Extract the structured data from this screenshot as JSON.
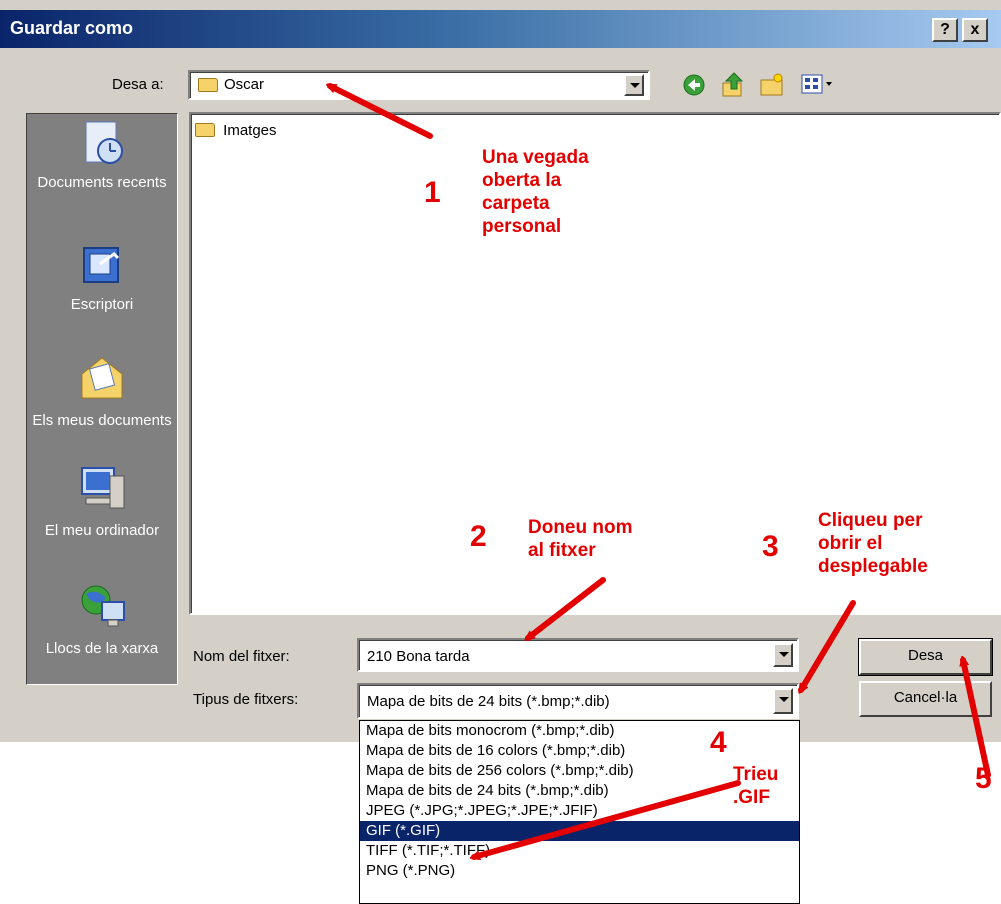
{
  "window": {
    "title": "Guardar como",
    "help_button": "?",
    "close_button": "x"
  },
  "toolbar": {
    "save_in_label": "Desa a:",
    "save_in_value": "Oscar",
    "icons": [
      "back-icon",
      "up-folder-icon",
      "new-folder-icon",
      "view-menu-icon"
    ]
  },
  "places": [
    {
      "label": "Documents recents",
      "icon": "recent-documents-icon"
    },
    {
      "label": "Escriptori",
      "icon": "desktop-icon"
    },
    {
      "label": "Els meus documents",
      "icon": "my-documents-icon"
    },
    {
      "label": "El meu ordinador",
      "icon": "my-computer-icon"
    },
    {
      "label": "Llocs de la xarxa",
      "icon": "network-places-icon"
    }
  ],
  "file_list": {
    "items": [
      "Imatges"
    ]
  },
  "form": {
    "filename_label": "Nom del fitxer:",
    "filename_value": "210 Bona tarda",
    "filetype_label": "Tipus de fitxers:",
    "filetype_value": "Mapa de bits de 24 bits (*.bmp;*.dib)"
  },
  "buttons": {
    "save": "Desa",
    "cancel": "Cancel·la"
  },
  "filetype_options": [
    "Mapa de bits monocrom (*.bmp;*.dib)",
    "Mapa de bits de 16 colors (*.bmp;*.dib)",
    "Mapa de bits de 256 colors (*.bmp;*.dib)",
    "Mapa de bits de 24 bits (*.bmp;*.dib)",
    "JPEG (*.JPG;*.JPEG;*.JPE;*.JFIF)",
    "GIF (*.GIF)",
    "TIFF (*.TIF;*.TIFF)",
    "PNG (*.PNG)"
  ],
  "selected_option_index": 5,
  "annotations": {
    "step1_number": "1",
    "step1_text": "Una vegada\noberta la\ncarpeta\npersonal",
    "step2_number": "2",
    "step2_text": "Doneu nom\nal fitxer",
    "step3_number": "3",
    "step3_text": "Cliqueu per\nobrir el\ndesplegable",
    "step4_number": "4",
    "step4_text": "Trieu\n.GIF",
    "step5_number": "5",
    "color": "#e30000"
  }
}
